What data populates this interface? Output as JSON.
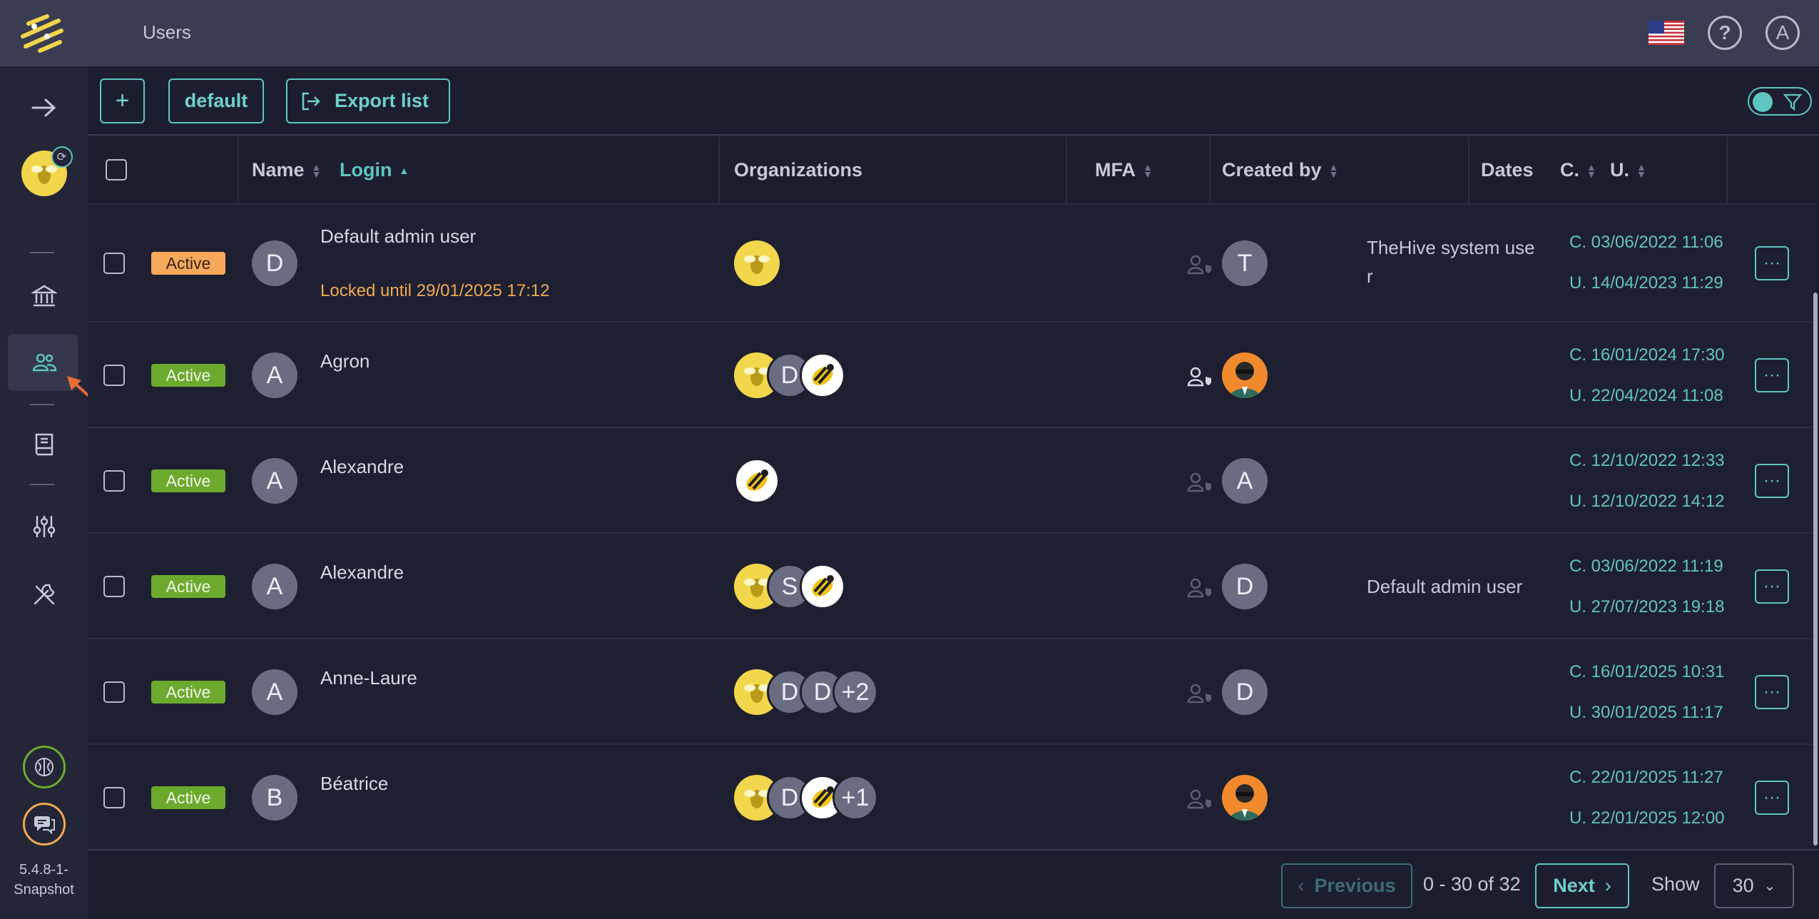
{
  "header": {
    "title": "Users",
    "help_icon": "?",
    "user_initial": "A"
  },
  "sidebar": {
    "version": "5.4.8-1-Snapshot",
    "version_line1": "5.4.8-1-",
    "version_line2": "Snapshot"
  },
  "toolbar": {
    "add_label": "+",
    "default_label": "default",
    "export_label": "Export list"
  },
  "table": {
    "headers": {
      "name": "Name",
      "login": "Login",
      "organizations": "Organizations",
      "mfa": "MFA",
      "created_by": "Created by",
      "dates": "Dates",
      "dates_c": "C.",
      "dates_u": "U."
    },
    "rows": [
      {
        "status": "Active",
        "initial": "D",
        "name": "Default admin user",
        "locked": "Locked until 29/01/2025 17:12",
        "orgs_extra": "",
        "org_initials": [],
        "creator_initial": "T",
        "creator_line1": "TheHive system use",
        "creator_line2": "r",
        "created": "C. 03/06/2022 11:06",
        "updated": "U. 14/04/2023 11:29"
      },
      {
        "status": "Active",
        "initial": "A",
        "name": "Agron",
        "org_initials": [
          "D"
        ],
        "orgs_extra": "",
        "creator_initial": "",
        "created": "C. 16/01/2024 17:30",
        "updated": "U. 22/04/2024 11:08"
      },
      {
        "status": "Active",
        "initial": "A",
        "name": "Alexandre",
        "org_initials": [],
        "orgs_extra": "",
        "creator_initial": "A",
        "created": "C. 12/10/2022 12:33",
        "updated": "U. 12/10/2022 14:12"
      },
      {
        "status": "Active",
        "initial": "A",
        "name": "Alexandre",
        "org_initials": [
          "S"
        ],
        "orgs_extra": "",
        "creator_initial": "D",
        "creator_name": "Default admin user",
        "created": "C. 03/06/2022 11:19",
        "updated": "U. 27/07/2023 19:18"
      },
      {
        "status": "Active",
        "initial": "A",
        "name": "Anne-Laure",
        "org_initials": [
          "D",
          "D"
        ],
        "orgs_extra": "+2",
        "creator_initial": "D",
        "created": "C. 16/01/2025 10:31",
        "updated": "U. 30/01/2025 11:17"
      },
      {
        "status": "Active",
        "initial": "B",
        "name": "Béatrice",
        "org_initials": [
          "D"
        ],
        "orgs_extra": "+1",
        "creator_initial": "",
        "created": "C. 22/01/2025 11:27",
        "updated": "U. 22/01/2025 12:00"
      }
    ],
    "actions_label": "···"
  },
  "pager": {
    "previous": "Previous",
    "range": "0 - 30 of 32",
    "next": "Next",
    "show_label": "Show",
    "page_size": "30"
  },
  "colors": {
    "accent": "#5fc5c0",
    "active_badge": "#6caa2e",
    "locked_badge": "#f7a85a",
    "topbar": "#3a3d51",
    "background": "#1c1e2e"
  }
}
